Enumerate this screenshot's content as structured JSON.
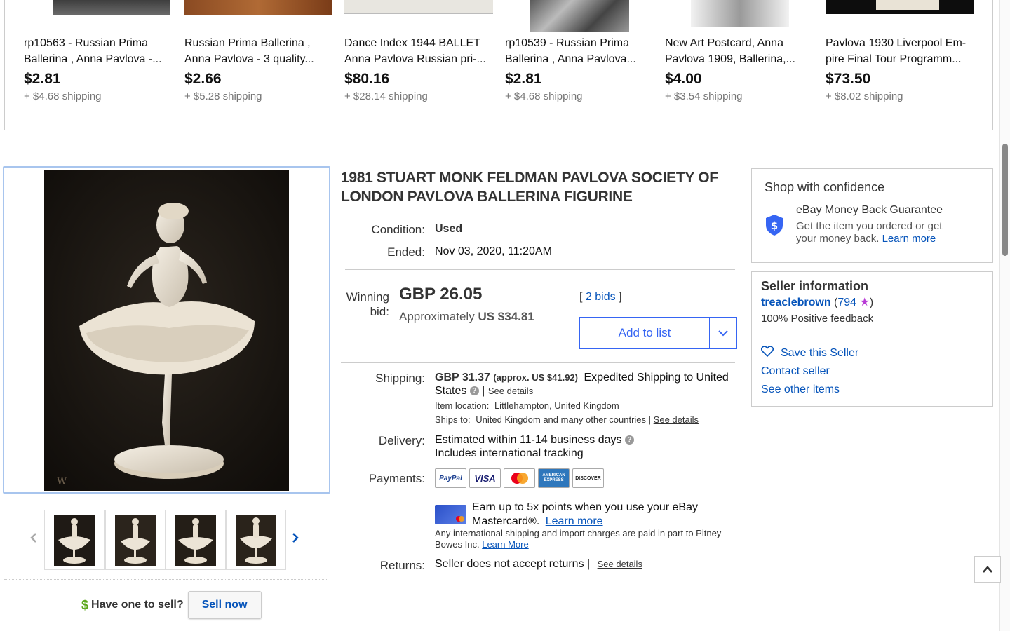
{
  "related_items": [
    {
      "title_line1": "rp10563 - Russian Prima",
      "title_line2": "Ballerina , Anna Pavlova -...",
      "price": "$2.81",
      "shipping": "+ $4.68 shipping"
    },
    {
      "title_line1": "Russian Prima Ballerina ,",
      "title_line2": "Anna Pavlova - 3 quality...",
      "price": "$2.66",
      "shipping": "+ $5.28 shipping"
    },
    {
      "title_line1": "Dance Index 1944 BALLET",
      "title_line2": "Anna Pavlova Russian pri-...",
      "price": "$80.16",
      "shipping": "+ $28.14 shipping"
    },
    {
      "title_line1": "rp10539 - Russian Prima",
      "title_line2": "Ballerina , Anna Pavlova...",
      "price": "$2.81",
      "shipping": "+ $4.68 shipping"
    },
    {
      "title_line1": "New Art Postcard, Anna",
      "title_line2": "Pavlova 1909, Ballerina,...",
      "price": "$4.00",
      "shipping": "+ $3.54 shipping"
    },
    {
      "title_line1": "Pavlova 1930 Liverpool Em-",
      "title_line2": "pire Final Tour Programm...",
      "price": "$73.50",
      "shipping": "+ $8.02 shipping"
    }
  ],
  "gallery": {
    "prev_icon": "chevron-left-icon",
    "next_icon": "chevron-right-icon",
    "watermark": "W"
  },
  "sell": {
    "question": "Have one to sell?",
    "button": "Sell now"
  },
  "item": {
    "title_line1": "1981 STUART MONK FELDMAN PAVLOVA SOCIETY OF",
    "title_line2": "LONDON PAVLOVA BALLERINA FIGURINE",
    "condition_label": "Condition:",
    "condition_value": "Used",
    "ended_label": "Ended:",
    "ended_value": "Nov 03, 2020, 11:20AM",
    "winning_label_1": "Winning",
    "winning_label_2": "bid:",
    "winning_price": "GBP 26.05",
    "approx_prefix": "Approximately",
    "approx_value": "US $34.81",
    "bids_open": "[",
    "bids_link": "2 bids",
    "bids_close": "]",
    "add_to_list": "Add to list"
  },
  "shipping": {
    "label": "Shipping:",
    "amount": "GBP 31.37",
    "approx": "(approx. US $41.92)",
    "method_line1": "Expedited Shipping to United",
    "method_line2": "States",
    "see_details": "See details",
    "location_label": "Item location:",
    "location_value": "Littlehampton, United Kingdom",
    "ships_to_label": "Ships to:",
    "ships_to_value": "United Kingdom and many other countries",
    "ships_see_details": "See details"
  },
  "delivery": {
    "label": "Delivery:",
    "line1": "Estimated within 11-14 business days",
    "line2": "Includes international tracking"
  },
  "payments": {
    "label": "Payments:",
    "methods": [
      "PayPal",
      "VISA",
      "Mastercard",
      "AMERICAN EXPRESS",
      "DISCOVER"
    ],
    "promo_line1": "Earn up to 5x points when you use your eBay",
    "promo_line2": "Mastercard®.",
    "promo_link": "Learn more",
    "intl_note_line1": "Any international shipping and import charges are paid in part to Pitney",
    "intl_note_line2": "Bowes Inc.",
    "intl_link": "Learn More"
  },
  "returns": {
    "label": "Returns:",
    "value": "Seller does not accept returns",
    "separator": "|",
    "see_details": "See details"
  },
  "confidence": {
    "title": "Shop with confidence",
    "guarantee_title": "eBay Money Back Guarantee",
    "guarantee_text_line1": "Get the item you ordered or get",
    "guarantee_text_line2": "your money back.",
    "learn_more": "Learn more"
  },
  "seller": {
    "title": "Seller information",
    "name": "treaclebrown",
    "score": "794",
    "feedback": "100% Positive feedback",
    "save": "Save this Seller",
    "contact": "Contact seller",
    "other_items": "See other items"
  },
  "colors": {
    "link": "#0654ba",
    "accent_blue": "#3665f3",
    "border": "#cccccc",
    "muted": "#767676",
    "star": "#b83bd6"
  }
}
